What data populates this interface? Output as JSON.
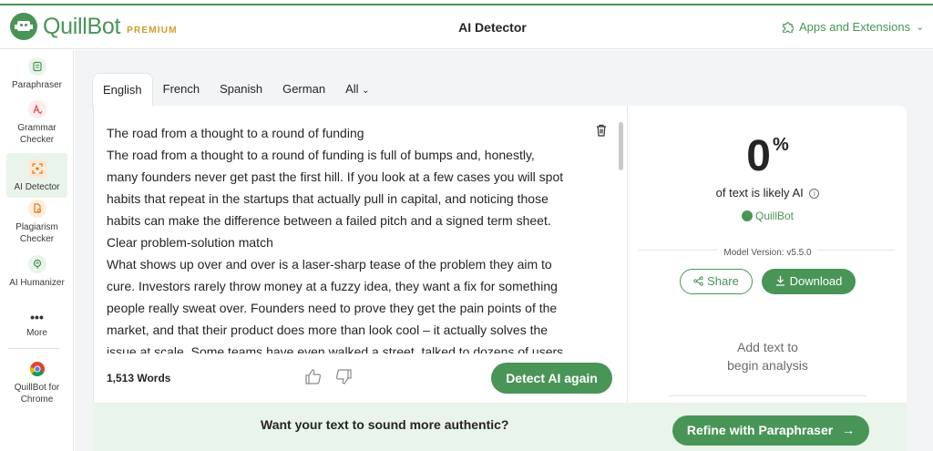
{
  "header": {
    "logo_text": "QuillBot",
    "logo_badge": "PREMIUM",
    "title": "AI Detector",
    "apps_label": "Apps and Extensions"
  },
  "sidebar": {
    "items": [
      {
        "label": "Paraphraser",
        "icon": "paraphraser-icon"
      },
      {
        "label": "Grammar Checker",
        "icon": "grammar-icon"
      },
      {
        "label": "AI Detector",
        "icon": "ai-detector-icon",
        "active": true
      },
      {
        "label": "Plagiarism Checker",
        "icon": "plagiarism-icon"
      },
      {
        "label": "AI Humanizer",
        "icon": "humanizer-icon"
      },
      {
        "label": "More",
        "icon": "more-icon"
      },
      {
        "label": "QuillBot for Chrome",
        "icon": "chrome-icon"
      }
    ]
  },
  "tabs": [
    "English",
    "French",
    "Spanish",
    "German",
    "All"
  ],
  "editor": {
    "lines": [
      "The road from a thought to a round of funding",
      "The road from a thought to a round of funding is full of bumps and, honestly,",
      "many founders never get past the first hill. If you look at a few cases you will spot",
      "habits that repeat in the startups that actually pull in capital, and noticing those",
      "habits can make the difference between a failed pitch and a signed term sheet.",
      "Clear problem-solution match",
      "What shows up over and over is a laser-sharp tease of the problem they aim to",
      "cure. Investors rarely throw money at a fuzzy idea, they want a fix for something",
      "people really sweat over. Founders need to prove they get the pain points of the",
      "market, and that their product does more than look cool – it actually solves the",
      "issue at scale. Some teams have even walked a street. talked to dozens of users."
    ],
    "word_count": "1,513 Words",
    "detect_button": "Detect AI again"
  },
  "results": {
    "percent": "0",
    "percent_sign": "%",
    "likely_text": "of text is likely AI",
    "brand": "QuillBot",
    "model_version": "Model Version: v5.5.0",
    "share_label": "Share",
    "download_label": "Download",
    "empty_line1": "Add text to",
    "empty_line2": "begin analysis"
  },
  "promo": {
    "text": "Want your text to sound more authentic?",
    "button": "Refine with Paraphraser"
  },
  "colors": {
    "brand_green": "#499557",
    "light_green": "#e9f4ea",
    "premium_gold": "#d29b2a"
  }
}
